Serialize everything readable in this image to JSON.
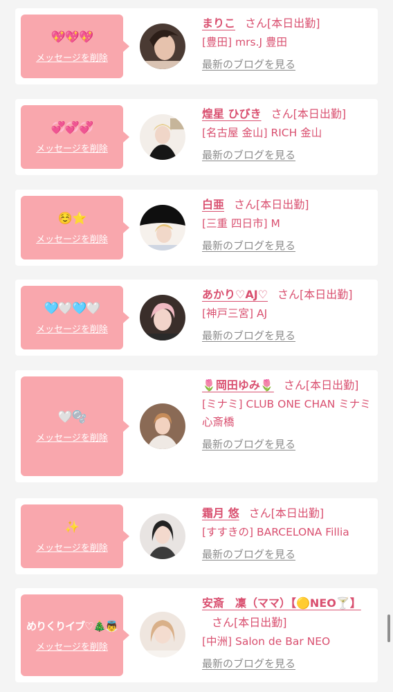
{
  "delete_label": "メッセージを削除",
  "san_label": "さん",
  "blog_label": "最新のブログを見る",
  "colors": {
    "accent": "#d94f6f",
    "bubble": "#f9a7ad",
    "link_gray": "#8a8a8a"
  },
  "entries": [
    {
      "emoji": "💖💖💖",
      "name": "まりこ",
      "status": "[本日出勤]",
      "shop": "[豊田] mrs.J 豊田"
    },
    {
      "emoji": "💞💞💞",
      "name": "煌星 ひびき",
      "status": "[本日出勤]",
      "shop": "[名古屋 金山] RICH 金山"
    },
    {
      "emoji": "☺️⭐",
      "name": "白亜",
      "status": "[本日出勤]",
      "shop": "[三重 四日市] M"
    },
    {
      "emoji": "🩵🤍🩵🤍",
      "name": "あかり♡AJ♡",
      "status": "[本日出勤]",
      "shop": "[神戸三宮] AJ"
    },
    {
      "emoji": "🤍🫧",
      "name": "🌷岡田ゆみ🌷",
      "status": "[本日出勤]",
      "shop": "[ミナミ] CLUB ONE CHAN ミナミ 心斎橋"
    },
    {
      "emoji": "✨",
      "name": "霜月 悠",
      "status": "[本日出勤]",
      "shop": "[すすきの] BARCELONA Fillia"
    },
    {
      "emoji": "めりくりイブ♡🎄👼",
      "name": "安斎　凜（ママ）【🟡NEO🍸】",
      "status": "[本日出勤]",
      "shop": "[中洲] Salon de Bar NEO"
    }
  ]
}
